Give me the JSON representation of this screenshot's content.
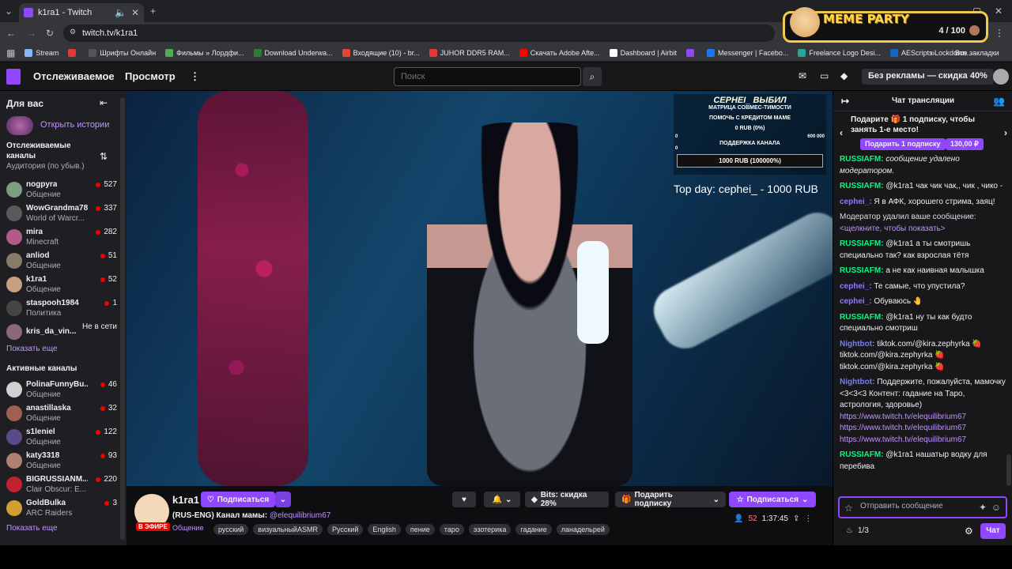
{
  "browser": {
    "tab_title": "k1ra1 - Twitch",
    "url": "twitch.tv/k1ra1",
    "bookmarks": [
      {
        "label": "Stream",
        "color": "#8ab4f8"
      },
      {
        "label": "",
        "color": "#e53935"
      },
      {
        "label": "Шрифты Онлайн",
        "color": "#555"
      },
      {
        "label": "Фильмы » Лордфи...",
        "color": "#4caf50"
      },
      {
        "label": "Download Underwa...",
        "color": "#2e7d32"
      },
      {
        "label": "Входящие (10) - br...",
        "color": "#ea4335"
      },
      {
        "label": "JUHOR DDR5 RAM...",
        "color": "#e53935"
      },
      {
        "label": "Скачать Adobe Afte...",
        "color": "#ff0000"
      },
      {
        "label": "Dashboard | Airbit",
        "color": "#ffffff"
      },
      {
        "label": "",
        "color": "#9147ff"
      },
      {
        "label": "Messenger | Facebo...",
        "color": "#1877f2"
      },
      {
        "label": "Freelance Logo Desi...",
        "color": "#26a69a"
      },
      {
        "label": "AEScripts Lockdown...",
        "color": "#1565c0"
      }
    ],
    "all_bookmarks": "Все закладки"
  },
  "meme_widget": {
    "title": "MEME PARTY",
    "count": "4 / 100"
  },
  "nav": {
    "following": "Отслеживаемое",
    "browse": "Просмотр",
    "search_placeholder": "Поиск",
    "no_ads": "Без рекламы — скидка 40%"
  },
  "sidebar": {
    "for_you": "Для вас",
    "open_stories": "Открыть истории",
    "followed_title": "Отслеживаемые каналы",
    "followed_sub": "Аудитория (по убыв.)",
    "followed": [
      {
        "name": "nogpyra",
        "category": "Общение",
        "viewers": "527",
        "color": "#7a9e7e"
      },
      {
        "name": "WowGrandma78",
        "category": "World of Warcr...",
        "viewers": "337",
        "color": "#5a5a5a"
      },
      {
        "name": "mira",
        "category": "Minecraft",
        "viewers": "282",
        "color": "#b05a8a"
      },
      {
        "name": "anliod",
        "category": "Общение",
        "viewers": "51",
        "color": "#8a7a6a"
      },
      {
        "name": "k1ra1",
        "category": "Общение",
        "viewers": "52",
        "color": "#c8a080"
      },
      {
        "name": "staspooh1984",
        "category": "Политика",
        "viewers": "1",
        "color": "#444"
      },
      {
        "name": "kris_da_vin...",
        "category": "",
        "viewers": "Не в сети",
        "color": "#8a6a7a"
      }
    ],
    "show_more_1": "Показать еще",
    "active_title": "Активные каналы",
    "active": [
      {
        "name": "PolinaFunnyBu...",
        "category": "Общение",
        "viewers": "46",
        "color": "#d0d0d0"
      },
      {
        "name": "anastillaska",
        "category": "Общение",
        "viewers": "32",
        "color": "#a06050"
      },
      {
        "name": "s1leniel",
        "category": "Общение",
        "viewers": "122",
        "color": "#5a4a8a"
      },
      {
        "name": "katy3318",
        "category": "Общение",
        "viewers": "93",
        "color": "#b08070"
      },
      {
        "name": "BIGRUSSIANM...",
        "category": "Clair Obscur: E...",
        "viewers": "220",
        "color": "#c02030"
      },
      {
        "name": "GoldBulka",
        "category": "ARC Raiders",
        "viewers": "3",
        "color": "#d0a030"
      }
    ],
    "show_more_2": "Показать еще"
  },
  "video_overlay": {
    "title": "СЕРНЕI_ ВЫБИЛ",
    "subtitle": "МАТРИЦА СОВМЕС-ТИМОСТИ",
    "help": "ПОМОЧЬ С КРЕДИТОМ МАМЕ",
    "help_amount": "0 RUB (0%)",
    "help_min": "0",
    "help_max": "600 000",
    "support": "ПОДДЕРЖКА КАНАЛА",
    "support_min": "0",
    "support_amount": "1000 RUB (100000%)",
    "top_day": "Top day: cephei_ - 1000 RUB"
  },
  "stream": {
    "channel": "k1ra1",
    "follow": "Подписаться",
    "title": "(RUS-ENG) Канал мамы:",
    "mention": "@elequilibrium67",
    "live": "В ЭФИРЕ",
    "category": "Общение",
    "tags": [
      "русский",
      "визуальныйASMR",
      "Русский",
      "English",
      "пение",
      "таро",
      "эзотерика",
      "гадание",
      "ланадельрей"
    ],
    "bits": "Bits: скидка 28%",
    "gift_sub": "Подарить подписку",
    "subscribe": "Подписаться",
    "viewers": "52",
    "uptime": "1:37:45"
  },
  "chat": {
    "header": "Чат трансляции",
    "gift_prompt": "Подарите 🎁 1 подписку, чтобы занять 1-е место!",
    "gift_button": "Подарить 1 подписку",
    "gift_price": "130,00 ₽",
    "messages": [
      {
        "user": "RUSSIAFM:",
        "color": "#00ff7f",
        "text": "сообщение удалено модератором.",
        "italic": true
      },
      {
        "user": "RUSSIAFM:",
        "color": "#00ff7f",
        "text": "@k1ra1 чак чик чак,, чик , чико -"
      },
      {
        "user": "cephei_:",
        "color": "#8a7bff",
        "text": "Я в АФК, хорошего стрима, заяц!"
      },
      {
        "user": "",
        "color": "#adadb8",
        "text": "Модератор удалил ваше сообщение:",
        "link": "<щелкните, чтобы показать>"
      },
      {
        "user": "RUSSIAFM:",
        "color": "#00ff7f",
        "text": "@k1ra1 а ты смотришь специально так? как взрослая тётя"
      },
      {
        "user": "RUSSIAFM:",
        "color": "#00ff7f",
        "text": "а не как наивная малышка"
      },
      {
        "user": "cephei_:",
        "color": "#8a7bff",
        "text": "Те самые, что упустила?"
      },
      {
        "user": "cephei_:",
        "color": "#8a7bff",
        "text": "Обуваюсь 🤚"
      },
      {
        "user": "RUSSIAFM:",
        "color": "#00ff7f",
        "text": "@k1ra1 ну ты как будто специально смотриш"
      },
      {
        "user": "Nightbot:",
        "color": "#7b7bff",
        "text": "tiktok.com/@kira.zephyrka 🍓 tiktok.com/@kira.zephyrka 🍓 tiktok.com/@kira.zephyrka 🍓"
      },
      {
        "user": "Nightbot:",
        "color": "#7b7bff",
        "text": "Поддержите, пожалуйста, мамочку <3<3<3 Контент: гадание на Таро, астрология, здоровье)",
        "link": "https://www.twitch.tv/elequilibrium67 https://www.twitch.tv/elequilibrium67 https://www.twitch.tv/elequilibrium67"
      },
      {
        "user": "RUSSIAFM:",
        "color": "#00ff7f",
        "text": "@k1ra1 нашатыр водку для перебива"
      }
    ],
    "input_placeholder": "Отправить сообщение",
    "points": "1/3",
    "send": "Чат"
  }
}
